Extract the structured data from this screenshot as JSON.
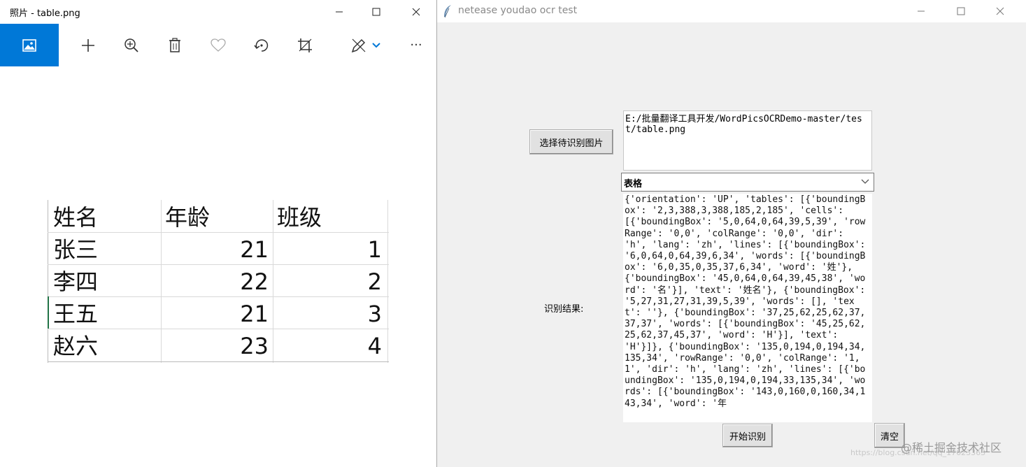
{
  "photos_window": {
    "title": "照片 - table.png",
    "toolbar": {
      "icons": [
        "picture-icon",
        "add-icon",
        "zoom-in-icon",
        "delete-icon",
        "heart-icon",
        "rotate-icon",
        "crop-icon",
        "edit-icon",
        "more-icon"
      ],
      "more_label": "···"
    },
    "table": {
      "headers": [
        "姓名",
        "年龄",
        "班级"
      ],
      "rows": [
        {
          "name": "张三",
          "age": "21",
          "class": "1"
        },
        {
          "name": "李四",
          "age": "22",
          "class": "2"
        },
        {
          "name": "王五",
          "age": "21",
          "class": "3"
        },
        {
          "name": "赵六",
          "age": "23",
          "class": "4"
        }
      ]
    }
  },
  "tk_window": {
    "title": "netease youdao ocr test",
    "select_button": "选择待识别图片",
    "path_value": "E:/批量翻译工具开发/WordPicsOCRDemo-master/test/table.png",
    "mode_value": "表格",
    "result_label": "识别结果:",
    "result_text": "{'orientation': 'UP', 'tables': [{'boundingBox': '2,3,388,3,388,185,2,185', 'cells': [{'boundingBox': '5,0,64,0,64,39,5,39', 'rowRange': '0,0', 'colRange': '0,0', 'dir': 'h', 'lang': 'zh', 'lines': [{'boundingBox': '6,0,64,0,64,39,6,34', 'words': [{'boundingBox': '6,0,35,0,35,37,6,34', 'word': '姓'}, {'boundingBox': '45,0,64,0,64,39,45,38', 'word': '名'}], 'text': '姓名'}, {'boundingBox': '5,27,31,27,31,39,5,39', 'words': [], 'text': ''}, {'boundingBox': '37,25,62,25,62,37,37,37', 'words': [{'boundingBox': '45,25,62,25,62,37,45,37', 'word': 'H'}], 'text': 'H'}]}, {'boundingBox': '135,0,194,0,194,34,135,34', 'rowRange': '0,0', 'colRange': '1,1', 'dir': 'h', 'lang': 'zh', 'lines': [{'boundingBox': '135,0,194,0,194,33,135,34', 'words': [{'boundingBox': '143,0,160,0,160,34,143,34', 'word': '年",
    "start_button": "开始识别",
    "clear_button": "清空"
  },
  "watermark": "@稀土掘金技术社区",
  "watermark_url": "https://blog.csdn.net/qq_17623363"
}
